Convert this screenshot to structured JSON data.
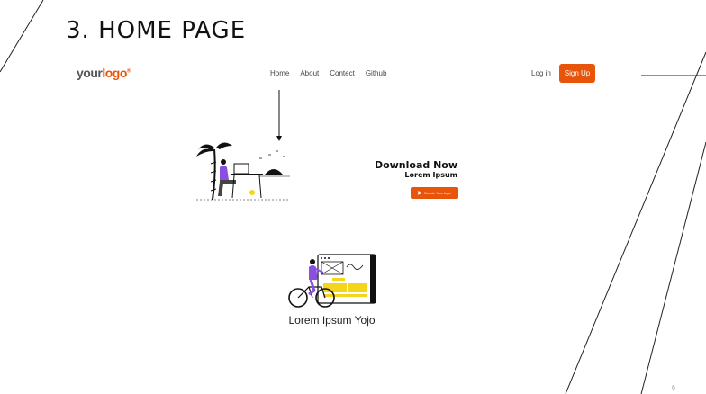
{
  "slide": {
    "title": "3. HOME PAGE",
    "page_number": "6"
  },
  "header": {
    "logo_part1": "your",
    "logo_part2": "logo",
    "logo_mark": "®",
    "nav": [
      "Home",
      "About",
      "Contect",
      "Github"
    ],
    "login_label": "Log in",
    "signup_label": "Sign Up"
  },
  "hero": {
    "title": "Download Now",
    "subtitle": "Lorem Ipsum",
    "cta_label": "Create Your logo"
  },
  "feature": {
    "caption": "Lorem Ipsum Yojo"
  },
  "colors": {
    "accent": "#e8540a",
    "illustration_purple": "#8a4fe0",
    "illustration_yellow": "#f2d51c"
  }
}
